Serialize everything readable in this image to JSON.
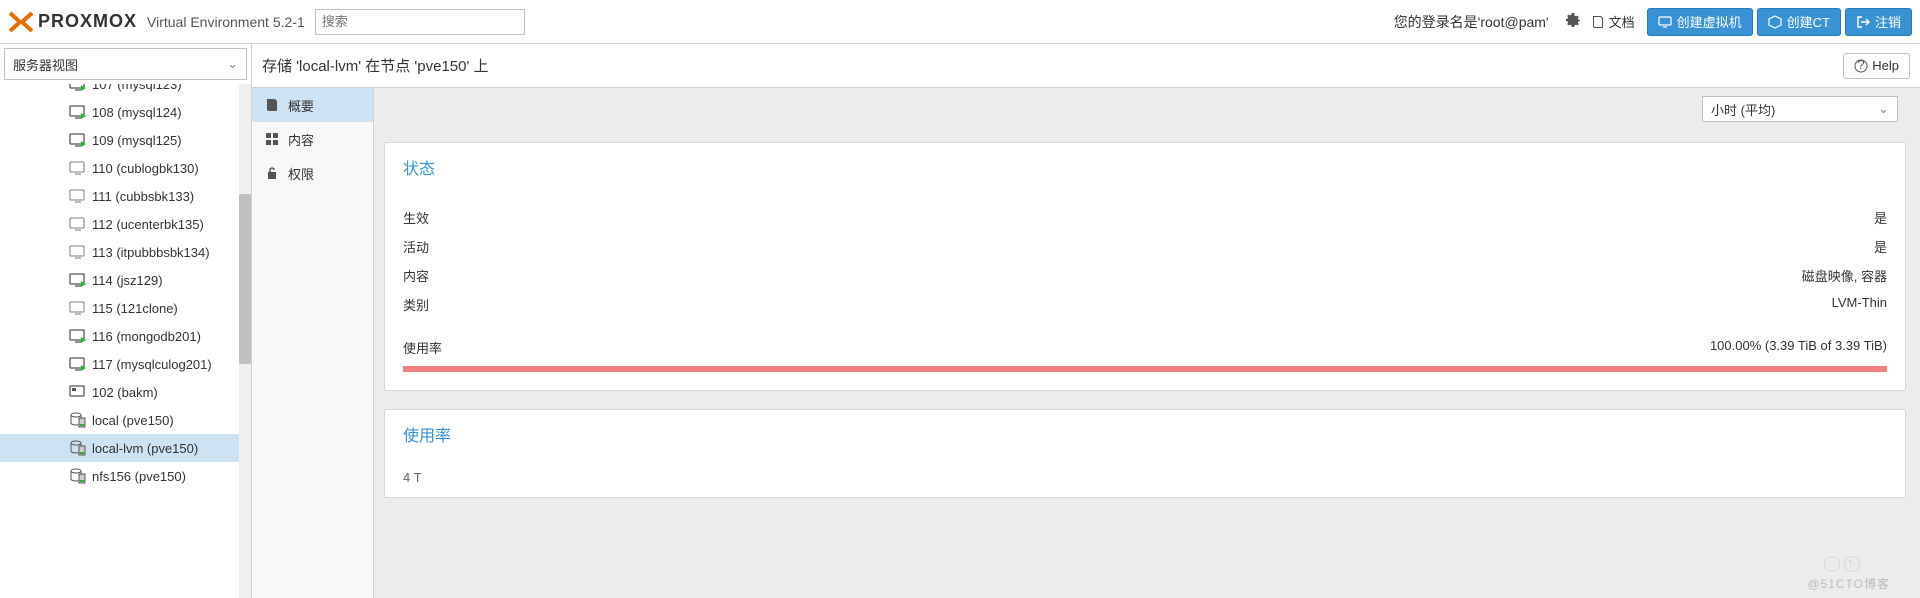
{
  "header": {
    "product": "PROXMOX",
    "version": "Virtual Environment 5.2-1",
    "search_placeholder": "搜索",
    "login_text": "您的登录名是'root@pam'",
    "doc_label": "文档",
    "create_vm": "创建虚拟机",
    "create_ct": "创建CT",
    "logout": "注销"
  },
  "sidebar": {
    "view_label": "服务器视图",
    "items": [
      {
        "label": "107 (mysql123)",
        "type": "vm-on",
        "cut": true
      },
      {
        "label": "108 (mysql124)",
        "type": "vm-on"
      },
      {
        "label": "109 (mysql125)",
        "type": "vm-on"
      },
      {
        "label": "110 (cublogbk130)",
        "type": "vm-off"
      },
      {
        "label": "111 (cubbsbk133)",
        "type": "vm-off"
      },
      {
        "label": "112 (ucenterbk135)",
        "type": "vm-off"
      },
      {
        "label": "113 (itpubbbsbk134)",
        "type": "vm-off"
      },
      {
        "label": "114 (jsz129)",
        "type": "vm-on"
      },
      {
        "label": "115 (121clone)",
        "type": "vm-off"
      },
      {
        "label": "116 (mongodb201)",
        "type": "vm-on"
      },
      {
        "label": "117 (mysqlculog201)",
        "type": "vm-on"
      },
      {
        "label": "102 (bakm)",
        "type": "ct"
      },
      {
        "label": "local (pve150)",
        "type": "storage"
      },
      {
        "label": "local-lvm (pve150)",
        "type": "storage",
        "sel": true
      },
      {
        "label": "nfs156 (pve150)",
        "type": "storage"
      }
    ]
  },
  "content": {
    "breadcrumb": "存储 'local-lvm' 在节点 'pve150' 上",
    "help": "Help",
    "tabs": [
      {
        "icon": "book",
        "label": "概要",
        "active": true
      },
      {
        "icon": "grid",
        "label": "内容"
      },
      {
        "icon": "lock",
        "label": "权限"
      }
    ],
    "time_select": "小时 (平均)",
    "status": {
      "title": "状态",
      "rows": [
        {
          "k": "生效",
          "v": "是"
        },
        {
          "k": "活动",
          "v": "是"
        },
        {
          "k": "内容",
          "v": "磁盘映像, 容器"
        },
        {
          "k": "类别",
          "v": "LVM-Thin"
        }
      ],
      "usage_label": "使用率",
      "usage_value": "100.00% (3.39 TiB of 3.39 TiB)"
    },
    "card2_title": "使用率",
    "card2_y": "4 T"
  },
  "watermark": "@51CTO博客"
}
